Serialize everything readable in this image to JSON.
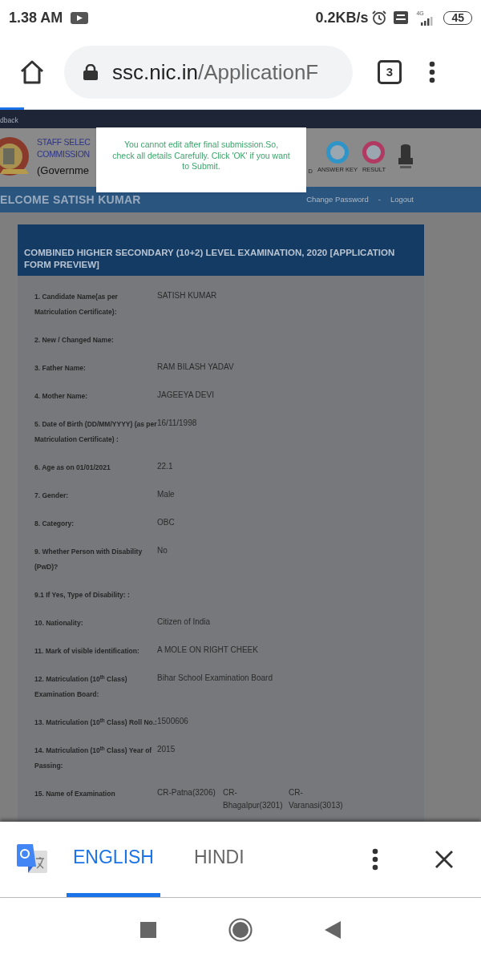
{
  "status_bar": {
    "time": "1.38 AM",
    "speed": "0.2KB/s",
    "network": "4G",
    "battery": "45"
  },
  "browser": {
    "url_host": "ssc.nic.in",
    "url_path": "/ApplicationF",
    "tab_count": "3",
    "progress": {
      "level": 0.05
    }
  },
  "site": {
    "top_link": "dback",
    "org_lines": [
      "STAFF SELEC",
      "COMMISSION"
    ],
    "org_sub": "(Governme",
    "nav_cut": "D",
    "nav_items": [
      {
        "label": "ANSWER KEY",
        "color": "#2f95c8"
      },
      {
        "label": "RESULT",
        "color": "#b03a62"
      }
    ],
    "welcome": "ELCOME SATISH KUMAR",
    "links": [
      {
        "label": "Change Password"
      },
      {
        "label": "Logout"
      }
    ],
    "link_separator": "-"
  },
  "dialog": {
    "message": "You cannot edit after final submission.So, check all details Carefully. Click 'OK' if you want to Submit."
  },
  "form": {
    "title": "COMBINED HIGHER SECONDARY (10+2) LEVEL EXAMINATION, 2020 [APPLICATION FORM PREVIEW]",
    "rows": [
      {
        "label": "1. Candidate Name(as per Matriculation Certificate):",
        "values": [
          "SATISH KUMAR"
        ]
      },
      {
        "label": "2. New / Changed Name:",
        "values": []
      },
      {
        "label": "3. Father Name:",
        "values": [
          "RAM BILASH YADAV"
        ]
      },
      {
        "label": "4. Mother Name:",
        "values": [
          "JAGEEYA DEVI"
        ]
      },
      {
        "label": "5. Date of Birth (DD/MM/YYYY) (as per Matriculation Certificate) :",
        "values": [
          "16/11/1998"
        ]
      },
      {
        "label": "6. Age as on 01/01/2021",
        "values": [
          "22.1"
        ]
      },
      {
        "label": "7. Gender:",
        "values": [
          "Male"
        ]
      },
      {
        "label": "8. Category:",
        "values": [
          "OBC"
        ]
      },
      {
        "label": "9. Whether Person with Disability (PwD)?",
        "values": [
          "No"
        ]
      },
      {
        "label": "9.1 If Yes, Type of Disability: :",
        "values": []
      },
      {
        "label": "10. Nationality:",
        "values": [
          "Citizen of India"
        ]
      },
      {
        "label": "11. Mark of visible identification:",
        "values": [
          "A MOLE ON RIGHT CHEEK"
        ]
      },
      {
        "label": "12. Matriculation (10$^{th}$ Class) Examination Board:",
        "values": [
          "Bihar School Examination Board"
        ]
      },
      {
        "label": "13. Matriculation (10$^{th}$ Class) Roll No.:",
        "values": [
          "1500606"
        ]
      },
      {
        "label": "14. Matriculation (10$^{th}$ Class) Year of Passing:",
        "values": [
          "2015"
        ]
      },
      {
        "label": "15. Name of Examination",
        "values": [
          "CR-Patna(3206)",
          "CR- Bhagalpur(3201)",
          "CR- Varanasi(3013)"
        ]
      }
    ]
  },
  "translate_bar": {
    "tabs": [
      {
        "label": "ENGLISH",
        "selected": true
      },
      {
        "label": "HINDI",
        "selected": false
      }
    ]
  }
}
